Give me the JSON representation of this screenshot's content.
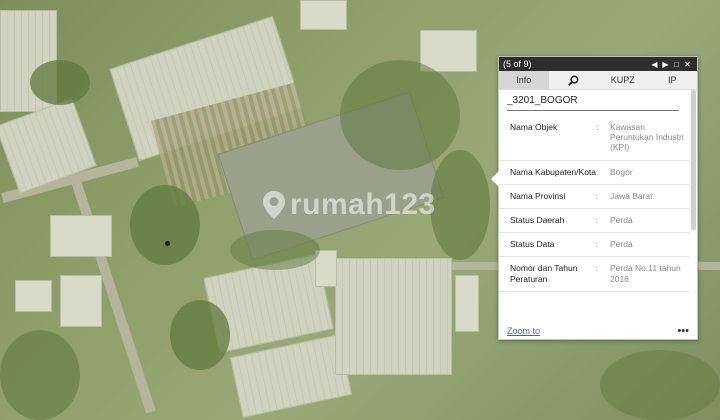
{
  "popup": {
    "counter": "(5 of 9)",
    "controls": {
      "prev": "◀",
      "next": "▶",
      "maximize": "□",
      "close": "✕"
    },
    "tabs": [
      "Info",
      "",
      "KUPZ",
      "IP"
    ],
    "title": "_3201_BOGOR",
    "rows": [
      {
        "key": "Nama Objek",
        "sep": ":",
        "value": "Kawasan Peruntukan Industri (KPI)"
      },
      {
        "key": "Nama Kabupaten/Kota",
        "sep": ":",
        "value": "Bogor"
      },
      {
        "key": "Nama Provinsi",
        "sep": ":",
        "value": "Jawa Barat"
      },
      {
        "key": "Status Daerah",
        "sep": ":",
        "value": "Perda"
      },
      {
        "key": "Status Data",
        "sep": ":",
        "value": "Perda"
      },
      {
        "key": "Nomor dan Tahun Peraturan",
        "sep": ":",
        "value": "Perda No.11 tahun 2016"
      }
    ],
    "zoom_link": "Zoom to",
    "more": "•••"
  },
  "watermark": "rumah123",
  "icons": {
    "search_tab": "search-icon",
    "more": "more-icon"
  }
}
